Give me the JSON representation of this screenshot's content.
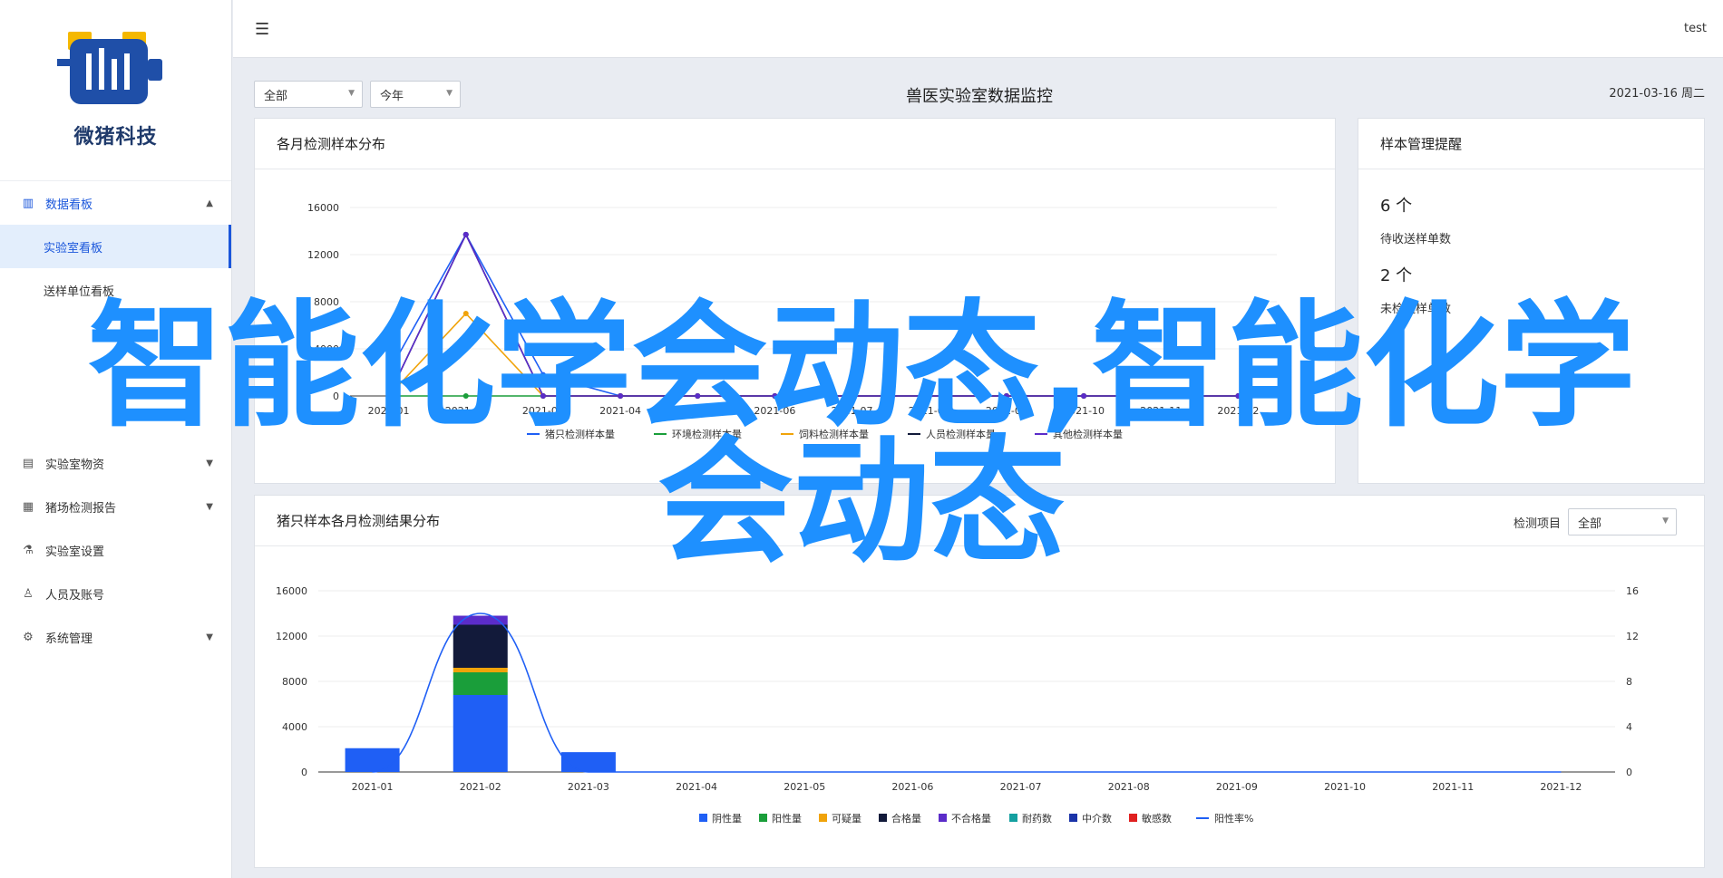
{
  "brand": {
    "name": "微猪科技"
  },
  "topbar": {
    "user": "test"
  },
  "sidebar": {
    "group": {
      "label": "数据看板",
      "icon": "bar-chart-icon"
    },
    "sub_items": [
      {
        "label": "实验室看板",
        "active": true
      },
      {
        "label": "送样单位看板",
        "active": false
      }
    ],
    "items": [
      {
        "label": "实验室物资",
        "icon": "document-icon"
      },
      {
        "label": "猪场检测报告",
        "icon": "report-icon"
      },
      {
        "label": "实验室设置",
        "icon": "flask-icon"
      },
      {
        "label": "人员及账号",
        "icon": "user-icon"
      },
      {
        "label": "系统管理",
        "icon": "gear-icon"
      }
    ]
  },
  "filters": {
    "scope": "全部",
    "period": "今年"
  },
  "page": {
    "title": "兽医实验室数据监控",
    "date": "2021-03-16 周二"
  },
  "panel_monthly": {
    "title": "各月检测样本分布"
  },
  "panel_reminder": {
    "title": "样本管理提醒",
    "items": [
      {
        "count": "6 个",
        "label": "待收送样单数"
      },
      {
        "count": "2 个",
        "label": "未检送样单数"
      }
    ]
  },
  "panel_result": {
    "title": "猪只样本各月检测结果分布",
    "filter_label": "检测项目",
    "filter_value": "全部"
  },
  "overlay": {
    "line1": "智能化学会动态,智能化学",
    "line2": "会动态"
  },
  "colors": {
    "primary": "#1a56db",
    "overlay": "#1e90ff",
    "blue": "#1f5ff5",
    "green": "#1a9e3a",
    "orange": "#f0a30a",
    "navy": "#121a3a",
    "purple": "#5b2cc9",
    "teal": "#14a0a0",
    "darkblue": "#1a33a8",
    "red": "#e02020"
  },
  "chart_data": [
    {
      "type": "line",
      "title": "各月检测样本分布",
      "categories": [
        "2021-01",
        "2021-02",
        "2021-03",
        "2021-04",
        "2021-05",
        "2021-06",
        "2021-07",
        "2021-08",
        "2021-09",
        "2021-10",
        "2021-11",
        "2021-12"
      ],
      "ylim": [
        0,
        16000
      ],
      "yticks": [
        "16000",
        "12000",
        "8000",
        "4000",
        "0"
      ],
      "legend_position": "bottom",
      "series": [
        {
          "name": "猪只检测样本量",
          "color": "#1f5ff5",
          "values": [
            2000,
            13700,
            1800,
            0,
            0,
            0,
            0,
            0,
            0,
            0,
            0,
            0
          ]
        },
        {
          "name": "环境检测样本量",
          "color": "#1a9e3a",
          "values": [
            0,
            0,
            0,
            0,
            0,
            0,
            0,
            0,
            0,
            0,
            0,
            0
          ]
        },
        {
          "name": "饲料检测样本量",
          "color": "#f0a30a",
          "values": [
            0,
            7000,
            0,
            0,
            0,
            0,
            0,
            0,
            0,
            0,
            0,
            0
          ]
        },
        {
          "name": "人员检测样本量",
          "color": "#121a3a",
          "values": [
            0,
            13700,
            0,
            0,
            0,
            0,
            0,
            0,
            0,
            0,
            0,
            0
          ]
        },
        {
          "name": "其他检测样本量",
          "color": "#5b2cc9",
          "values": [
            0,
            13700,
            0,
            0,
            0,
            0,
            0,
            0,
            0,
            0,
            0,
            0
          ]
        }
      ]
    },
    {
      "type": "bar",
      "title": "猪只样本各月检测结果分布",
      "categories": [
        "2021-01",
        "2021-02",
        "2021-03",
        "2021-04",
        "2021-05",
        "2021-06",
        "2021-07",
        "2021-08",
        "2021-09",
        "2021-10",
        "2021-11",
        "2021-12"
      ],
      "ylim": [
        0,
        16000
      ],
      "y2lim": [
        0,
        16
      ],
      "yticks": [
        "16000",
        "12000",
        "8000",
        "4000",
        "0"
      ],
      "y2ticks": [
        "16",
        "12",
        "8",
        "4",
        "0"
      ],
      "stacked": true,
      "legend_position": "bottom",
      "series": [
        {
          "name": "阴性量",
          "color": "#1f5ff5",
          "values": [
            2100,
            6800,
            1750,
            0,
            0,
            0,
            0,
            0,
            0,
            0,
            0,
            0
          ]
        },
        {
          "name": "阳性量",
          "color": "#1a9e3a",
          "values": [
            0,
            2000,
            0,
            0,
            0,
            0,
            0,
            0,
            0,
            0,
            0,
            0
          ]
        },
        {
          "name": "可疑量",
          "color": "#f0a30a",
          "values": [
            0,
            400,
            0,
            0,
            0,
            0,
            0,
            0,
            0,
            0,
            0,
            0
          ]
        },
        {
          "name": "合格量",
          "color": "#121a3a",
          "values": [
            0,
            3800,
            0,
            0,
            0,
            0,
            0,
            0,
            0,
            0,
            0,
            0
          ]
        },
        {
          "name": "不合格量",
          "color": "#5b2cc9",
          "values": [
            0,
            800,
            0,
            0,
            0,
            0,
            0,
            0,
            0,
            0,
            0,
            0
          ]
        },
        {
          "name": "耐药数",
          "color": "#14a0a0",
          "values": [
            0,
            0,
            0,
            0,
            0,
            0,
            0,
            0,
            0,
            0,
            0,
            0
          ]
        },
        {
          "name": "中介数",
          "color": "#1a33a8",
          "values": [
            0,
            0,
            0,
            0,
            0,
            0,
            0,
            0,
            0,
            0,
            0,
            0
          ]
        },
        {
          "name": "敏感数",
          "color": "#e02020",
          "values": [
            0,
            0,
            0,
            0,
            0,
            0,
            0,
            0,
            0,
            0,
            0,
            0
          ]
        }
      ],
      "line_series": {
        "name": "阳性率%",
        "color": "#1f5ff5",
        "axis": "right",
        "values": [
          0,
          14,
          0,
          0,
          0,
          0,
          0,
          0,
          0,
          0,
          0,
          0
        ]
      }
    }
  ]
}
